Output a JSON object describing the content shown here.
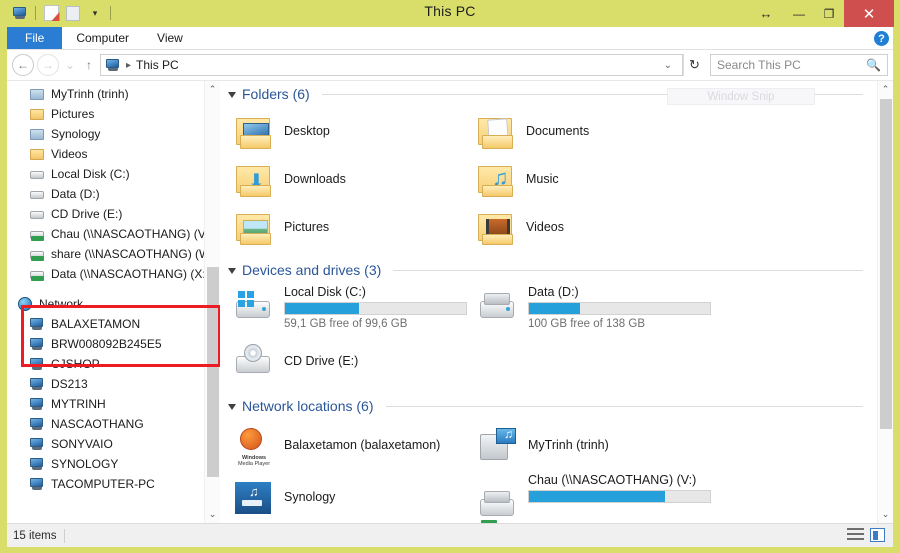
{
  "window": {
    "title": "This PC",
    "quick_access": [
      "this-pc-icon",
      "properties-icon",
      "new-folder-icon",
      "customize-chevron-icon"
    ],
    "controls": {
      "resize": "↔",
      "minimize": "—",
      "maximize": "❐",
      "close": "✕"
    },
    "border_color": "#d9de6b"
  },
  "ribbon": {
    "tabs": [
      {
        "label": "File",
        "active": true
      },
      {
        "label": "Computer",
        "active": false
      },
      {
        "label": "View",
        "active": false
      }
    ],
    "collapse_icon": "chevron-down-icon",
    "help_icon": "?"
  },
  "address_bar": {
    "back": "←",
    "forward": "→",
    "recent_chevron": "⌄",
    "up": "↑",
    "crumb_icon": "this-pc-icon",
    "path": "This PC",
    "separator": "▸",
    "dropdown_chevron": "⌄",
    "refresh": "↻"
  },
  "search": {
    "placeholder": "Search This PC",
    "value": "",
    "icon": "search-icon"
  },
  "sidebar": {
    "items": [
      {
        "label": "MyTrinh (trinh)",
        "icon": "network-folder-icon",
        "level": 2
      },
      {
        "label": "Pictures",
        "icon": "pictures-folder-icon",
        "level": 2
      },
      {
        "label": "Synology",
        "icon": "network-folder-icon",
        "level": 2
      },
      {
        "label": "Videos",
        "icon": "videos-folder-icon",
        "level": 2
      },
      {
        "label": "Local Disk (C:)",
        "icon": "windows-drive-icon",
        "level": 2
      },
      {
        "label": "Data (D:)",
        "icon": "drive-icon",
        "level": 2
      },
      {
        "label": "CD Drive (E:)",
        "icon": "cd-drive-icon",
        "level": 2
      },
      {
        "label": "Chau (\\\\NASCAOTHANG) (V:)",
        "icon": "network-drive-icon",
        "level": 2,
        "highlighted": true
      },
      {
        "label": "share (\\\\NASCAOTHANG) (W:)",
        "icon": "network-drive-icon",
        "level": 2,
        "highlighted": true
      },
      {
        "label": "Data (\\\\NASCAOTHANG) (X:)",
        "icon": "network-drive-icon",
        "level": 2,
        "highlighted": true
      }
    ],
    "network_root": {
      "label": "Network",
      "icon": "network-globe-icon"
    },
    "network_items": [
      {
        "label": "BALAXETAMON",
        "icon": "computer-icon"
      },
      {
        "label": "BRW008092B245E5",
        "icon": "computer-icon"
      },
      {
        "label": "CJSHOP",
        "icon": "computer-icon"
      },
      {
        "label": "DS213",
        "icon": "computer-icon"
      },
      {
        "label": "MYTRINH",
        "icon": "computer-icon"
      },
      {
        "label": "NASCAOTHANG",
        "icon": "computer-icon"
      },
      {
        "label": "SONYVAIO",
        "icon": "computer-icon"
      },
      {
        "label": "SYNOLOGY",
        "icon": "computer-icon"
      },
      {
        "label": "TACOMPUTER-PC",
        "icon": "computer-icon"
      }
    ],
    "scroll_up_icon": "⌃",
    "scroll_down_icon": "⌄",
    "annotation_color": "#ee1b24"
  },
  "main": {
    "groups": [
      {
        "title": "Folders (6)",
        "type": "folders",
        "items": [
          {
            "label": "Desktop",
            "icon": "desktop-folder-icon"
          },
          {
            "label": "Documents",
            "icon": "documents-folder-icon"
          },
          {
            "label": "Downloads",
            "icon": "downloads-folder-icon"
          },
          {
            "label": "Music",
            "icon": "music-folder-icon"
          },
          {
            "label": "Pictures",
            "icon": "pictures-folder-icon"
          },
          {
            "label": "Videos",
            "icon": "videos-folder-icon"
          }
        ]
      },
      {
        "title": "Devices and drives (3)",
        "type": "drives",
        "items": [
          {
            "label": "Local Disk (C:)",
            "icon": "windows-drive-icon",
            "free_text": "59,1 GB free of 99,6 GB",
            "used_percent": 41,
            "bar_color": "#26a0da"
          },
          {
            "label": "Data (D:)",
            "icon": "drive-icon",
            "free_text": "100 GB free of 138 GB",
            "used_percent": 28,
            "bar_color": "#26a0da"
          },
          {
            "label": "CD Drive (E:)",
            "icon": "cd-drive-icon",
            "free_text": "",
            "used_percent": 0,
            "bar_color": "#26a0da"
          }
        ]
      },
      {
        "title": "Network locations (6)",
        "type": "network",
        "items": [
          {
            "label": "Balaxetamon (balaxetamon)",
            "icon": "windows-media-player-icon",
            "free_text": "",
            "used_percent": 0
          },
          {
            "label": "MyTrinh (trinh)",
            "icon": "media-drive-icon",
            "free_text": "",
            "used_percent": 0
          },
          {
            "label": "Synology",
            "icon": "synology-icon",
            "free_text": "",
            "used_percent": 0
          },
          {
            "label": "Chau (\\\\NASCAOTHANG) (V:)",
            "icon": "network-drive-icon",
            "free_text": "",
            "used_percent": 75,
            "bar_color": "#26a0da"
          }
        ]
      }
    ],
    "scroll_up_icon": "⌃",
    "scroll_down_icon": "⌄"
  },
  "watermark": {
    "label": "Window Snip"
  },
  "statusbar": {
    "item_count": "15 items",
    "view_buttons": [
      {
        "name": "details-view-button",
        "icon": "list-view-icon"
      },
      {
        "name": "large-icons-view-button",
        "icon": "tile-view-icon"
      }
    ]
  },
  "wmp_caption": {
    "line1": "Windows",
    "line2": "Media Player"
  }
}
